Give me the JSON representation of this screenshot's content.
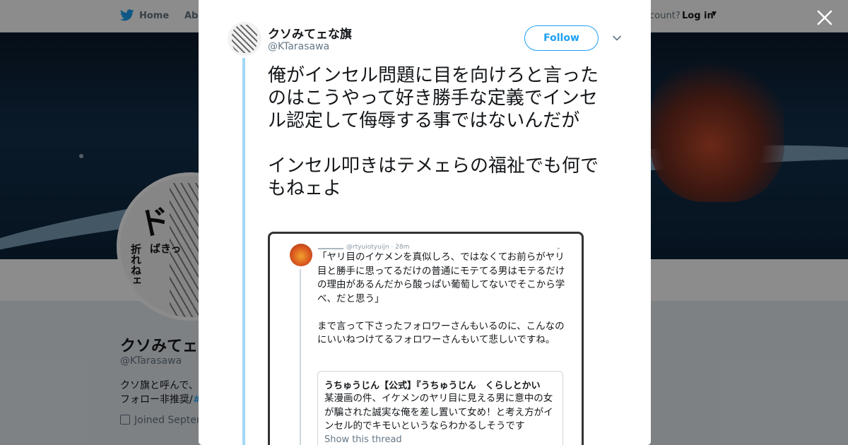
{
  "topnav": {
    "home": "Home",
    "about": "Abo",
    "account_prompt": "ccount?",
    "login": "Log in"
  },
  "profile": {
    "name": "クソみてェ",
    "handle": "@KTarasawa",
    "bio_line1": "クソ旗と呼んで、",
    "bio_line2": "フォロー非推奨/",
    "bio_hashtag": "#",
    "joined": "Joined Septen"
  },
  "tweet": {
    "author_name": "クソみてェな旗",
    "author_handle": "@KTarasawa",
    "follow_label": "Follow",
    "paragraphs": [
      "俺がインセル問題に目を向けろと言ったのはこうやって好き勝手な定義でインセル認定して侮辱する事ではないんだが",
      "インセル叩きはテメェらの福祉でも何でもねェよ"
    ]
  },
  "embedded_screenshot": {
    "meta": "@rtyuiotyuijn · 28m",
    "chevron": "⌄",
    "paragraphs": [
      "「ヤリ目のイケメンを真似しろ、ではなくてお前らがヤリ目と勝手に思ってるだけの普通にモテてる男はモテるだけの理由があるんだから酸っぱい葡萄してないでそこから学べ、だと思う」",
      "まで言って下さったフォロワーさんもいるのに、こんなのにいいねつけてるフォロワーさんもいて悲しいですね。"
    ],
    "quote": {
      "name": "うちゅうじん【公式】『うちゅうじん　くらしとかい",
      "body": "某漫画の件、イケメンのヤリ目に見える男に意中の女が騙された誠実な俺を差し置いて女め！と考え方がインセル的でキモいというならわかるしそうです",
      "link": "Show this thread"
    }
  },
  "colors": {
    "twitter_blue": "#1da1f2",
    "thread_line": "#a3d7f7",
    "overlay": "rgba(0,0,0,0.45)"
  },
  "icons": [
    "twitter-bird-icon",
    "caret-down-icon",
    "close-icon",
    "chevron-down-icon",
    "calendar-icon"
  ]
}
